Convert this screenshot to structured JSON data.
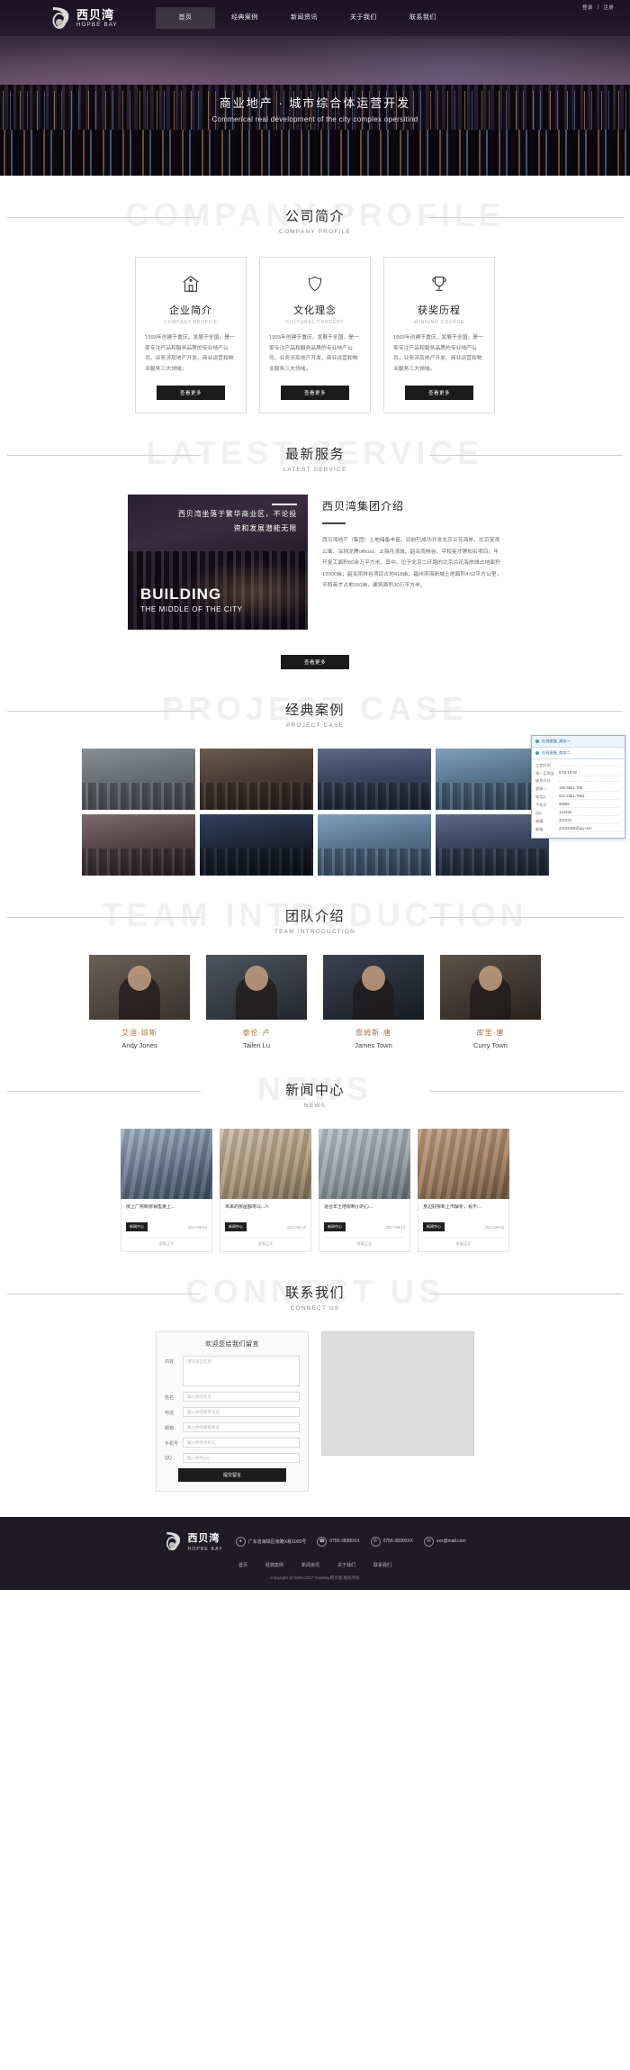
{
  "header": {
    "top_links": [
      {
        "label": "登录"
      },
      {
        "label": "注册"
      }
    ],
    "separator": "|",
    "logo": {
      "cn": "西贝湾",
      "en": "HOPBE BAY"
    },
    "nav": [
      {
        "label": "首页",
        "active": true
      },
      {
        "label": "经典案例",
        "active": false
      },
      {
        "label": "新闻资讯",
        "active": false
      },
      {
        "label": "关于我们",
        "active": false
      },
      {
        "label": "联系我们",
        "active": false
      }
    ]
  },
  "hero": {
    "title_cn": "商业地产 · 城市综合体运营开发",
    "title_en": "Commerical real development of the city complex opersitind"
  },
  "sections": {
    "profile": {
      "watermark": "COMPANY PROFILE",
      "title": "公司简介",
      "subtitle": "COMPANY PROFILE",
      "cards": [
        {
          "icon": "house-icon",
          "title": "企业简介",
          "subtitle": "COMPANY PROFILE",
          "body": "1993年创建于重庆，发展于全国，是一家专注产品和服务品质的专业地产公司，业务涉及地产开发、商业运营和物业服务三大领域。",
          "button": "查看更多"
        },
        {
          "icon": "shield-icon",
          "title": "文化理念",
          "subtitle": "CULTURAL CONCEPT",
          "body": "1993年创建于重庆，发展于全国，是一家专注产品和服务品质的专业地产公司，业务涉及地产开发、商业运营和物业服务三大领域。",
          "button": "查看更多"
        },
        {
          "icon": "trophy-icon",
          "title": "获奖历程",
          "subtitle": "WINNING COURSE",
          "body": "1993年创建于重庆，发展于全国，是一家专注产品和服务品质的专业地产公司，业务涉及地产开发、商业运营和物业服务三大领域。",
          "button": "查看更多"
        }
      ]
    },
    "service": {
      "watermark": "LATEST SERVICE",
      "title": "最新服务",
      "subtitle": "LATEST SERVICE",
      "image_line1": "西贝湾坐落于繁华商业区，不论投",
      "image_line2": "资和发展潜能无限",
      "image_big1": "BUILDING",
      "image_big2": "THE MIDDLE OF THE CITY",
      "heading": "西贝湾集团介绍",
      "body": "西贝湾地产（集团）土地储备丰富。目前已成功开发北京兰花海岸、北京宝湾公寓、深圳龙腾official、上海月湾城、韶关雨林谷、平和英才等知名项目，年开复工面积60余万平方米。其中，位于北京二环路的北京兰花海岸城占地面积12000亩；韶关雨林谷项目占地418亩；福州滨海新城土地面积4.62平方公里，平和英才占地160亩，建筑面积30万平方米。",
      "button": "查看更多"
    },
    "case": {
      "watermark": "PROJECT CASE",
      "title": "经典案例",
      "subtitle": "PROJECT CASE"
    },
    "team": {
      "watermark": "TEAM INTRODUCTION",
      "title": "团队介绍",
      "subtitle": "TEAM INTRODUCTION",
      "members": [
        {
          "cn": "艾迪·琼斯",
          "en": "Andy Jones"
        },
        {
          "cn": "泰伦·卢",
          "en": "Tailen Lu"
        },
        {
          "cn": "詹姆斯·唐",
          "en": "James Town"
        },
        {
          "cn": "库里·唐",
          "en": "Curry Town"
        }
      ]
    },
    "news": {
      "watermark": "NEWS",
      "title": "新闻中心",
      "subtitle": "NEWS",
      "items": [
        {
          "title": "房上厂房新房销售量上...",
          "tag": "新闻中心",
          "date": "2017-09-12",
          "more": "查看正文"
        },
        {
          "title": "未来的房屋都将以...人",
          "tag": "新闻中心",
          "date": "2017-09-12",
          "more": "查看正文"
        },
        {
          "title": "适合年士地限制小的心...",
          "tag": "新闻中心",
          "date": "2017-09-13",
          "more": "查看正文"
        },
        {
          "title": "身边好房新上市解析，看不...",
          "tag": "新闻中心",
          "date": "2017-09-12",
          "more": "查看正文"
        }
      ]
    },
    "connect": {
      "watermark": "CONNECT US",
      "title": "联系我们",
      "subtitle": "CONNECT US",
      "form": {
        "heading": "欢迎您给我们留言",
        "fields": [
          {
            "label": "内容",
            "placeholder": "填写留言信息",
            "type": "textarea"
          },
          {
            "label": "姓名",
            "placeholder": "输入你的姓名"
          },
          {
            "label": "电话",
            "placeholder": "输入你的联系电话"
          },
          {
            "label": "邮箱",
            "placeholder": "输入你的邮箱地址"
          },
          {
            "label": "手机号",
            "placeholder": "输入你的手机号"
          },
          {
            "label": "QQ",
            "placeholder": "输入你的QQ"
          }
        ],
        "submit": "提交留言"
      }
    }
  },
  "contact_widget": {
    "tabs": [
      {
        "label": "在线客服_商务一"
      },
      {
        "label": "在线客服_商务二"
      }
    ],
    "rows": [
      {
        "k": "工作时间",
        "v": ""
      },
      {
        "k": "周一至周五",
        "v": "8:00-18:00"
      },
      {
        "k": "联系方式",
        "v": ""
      },
      {
        "k": "客服一",
        "v": "186-4561-766"
      },
      {
        "k": "电话2",
        "v": "021-2361-7962"
      },
      {
        "k": "手机号",
        "v": "66586"
      },
      {
        "k": "QQ",
        "v": "123456"
      },
      {
        "k": "邮编",
        "v": "222222"
      },
      {
        "k": "邮箱",
        "v": "22102406@qq.com"
      }
    ]
  },
  "footer": {
    "logo": {
      "cn": "西贝湾",
      "en": "HOPBE BAY"
    },
    "address": "广东省海珠区南路X栋1000号",
    "phone": "0756-38300XX",
    "tel": "0756-38300XX",
    "email": "xxx@mail.com",
    "nav": [
      {
        "label": "首页"
      },
      {
        "label": "经典案例"
      },
      {
        "label": "新闻资讯"
      },
      {
        "label": "关于我们"
      },
      {
        "label": "联系我们"
      }
    ],
    "copyright": "Copyright @ 2006-2017 hopebay网页版  版权所有"
  }
}
